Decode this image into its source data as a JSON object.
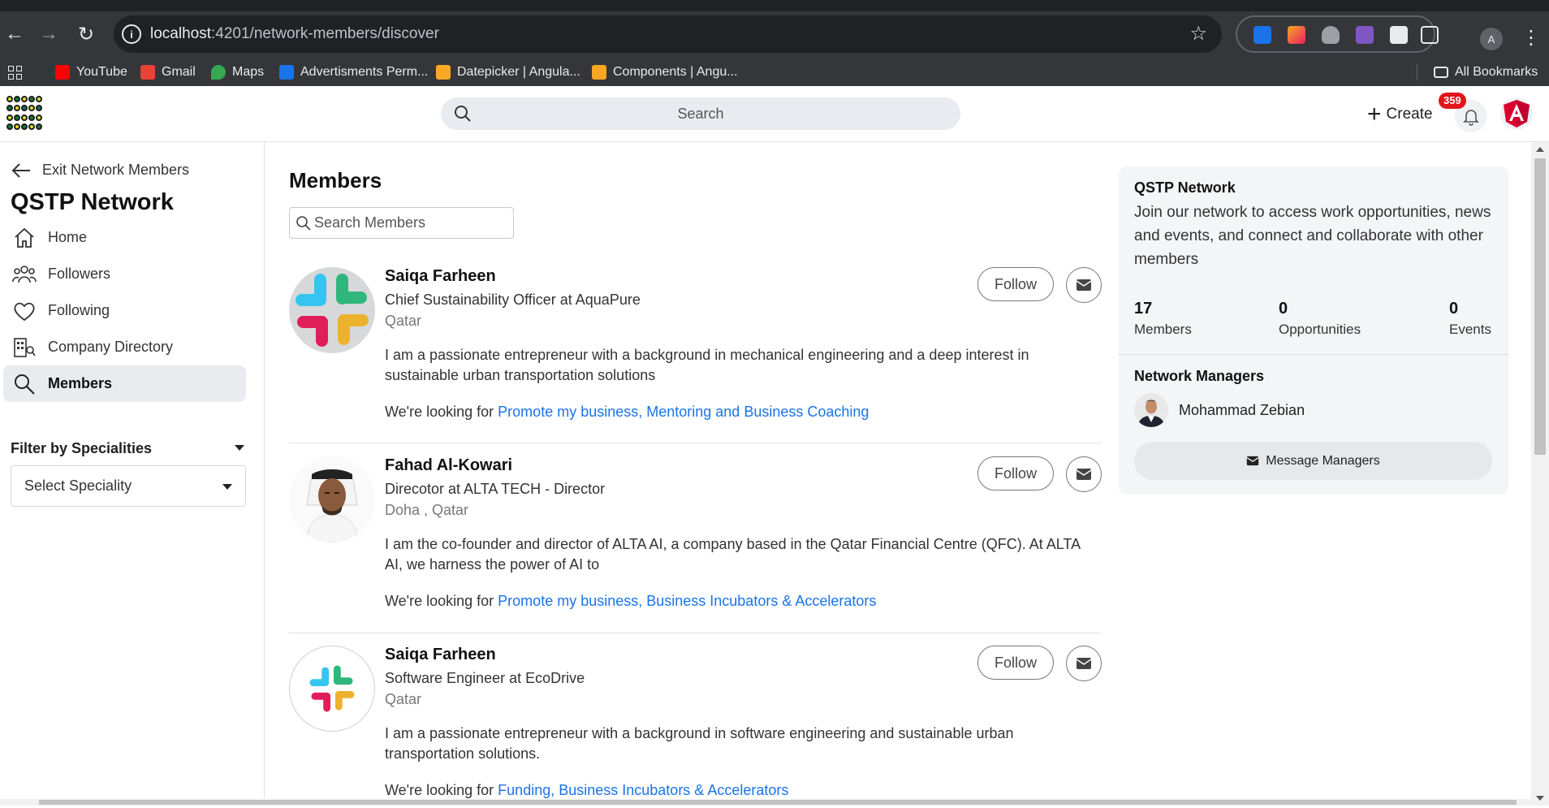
{
  "browser": {
    "url_host": "localhost",
    "url_rest": ":4201/network-members/discover",
    "profile_initial": "A",
    "bookmarks": [
      {
        "label": "YouTube",
        "color": "#ff0000"
      },
      {
        "label": "Gmail",
        "color": "#ea4335"
      },
      {
        "label": "Maps",
        "color": "#34a853"
      },
      {
        "label": "Advertisments Perm...",
        "color": "#1a73e8"
      },
      {
        "label": "Datepicker | Angula...",
        "color": "#f9a825"
      },
      {
        "label": "Components | Angu...",
        "color": "#f9a825"
      }
    ],
    "all_bookmarks": "All Bookmarks"
  },
  "header": {
    "search_placeholder": "Search",
    "create_label": "Create",
    "notification_count": "359"
  },
  "sidebar": {
    "exit_label": "Exit Network Members",
    "network_name": "QSTP Network",
    "items": [
      {
        "label": "Home",
        "icon": "home-icon"
      },
      {
        "label": "Followers",
        "icon": "followers-icon"
      },
      {
        "label": "Following",
        "icon": "heart-icon"
      },
      {
        "label": "Company Directory",
        "icon": "building-icon"
      },
      {
        "label": "Members",
        "icon": "search-icon",
        "active": true
      }
    ],
    "filter_title": "Filter by Specialities",
    "select_label": "Select Speciality"
  },
  "main": {
    "title": "Members",
    "search_placeholder": "Search Members",
    "follow_label": "Follow",
    "looking_prefix": "We're looking for ",
    "members": [
      {
        "name": "Saiqa Farheen",
        "role": "Chief Sustainability Officer at AquaPure",
        "location": "Qatar",
        "bio": "I am a passionate entrepreneur with a background in mechanical engineering and a deep interest in sustainable urban transportation solutions",
        "looking_for": "Promote my business, Mentoring and Business Coaching"
      },
      {
        "name": "Fahad Al-Kowari",
        "role": "Direcotor at ALTA TECH - Director",
        "location": "Doha , Qatar",
        "bio": "I am the co-founder and director of ALTA AI, a company based in the Qatar Financial Centre (QFC). At ALTA AI, we harness the power of AI to",
        "looking_for": "Promote my business, Business Incubators & Accelerators"
      },
      {
        "name": "Saiqa Farheen",
        "role": "Software Engineer at EcoDrive",
        "location": "Qatar",
        "bio": "I am a passionate entrepreneur with a background in software engineering and sustainable urban transportation solutions.",
        "looking_for": "Funding, Business Incubators & Accelerators"
      }
    ]
  },
  "panel": {
    "title": "QSTP Network",
    "description": "Join our network to access work opportunities, news and events, and connect and collaborate with other members",
    "stats": [
      {
        "value": "17",
        "label": "Members"
      },
      {
        "value": "0",
        "label": "Opportunities"
      },
      {
        "value": "0",
        "label": "Events"
      }
    ],
    "managers_title": "Network Managers",
    "manager_name": "Mohammad Zebian",
    "message_label": "Message Managers"
  },
  "colors": {
    "link": "#1a73e8",
    "badge": "#e3141b",
    "angular": "#dd0031"
  }
}
